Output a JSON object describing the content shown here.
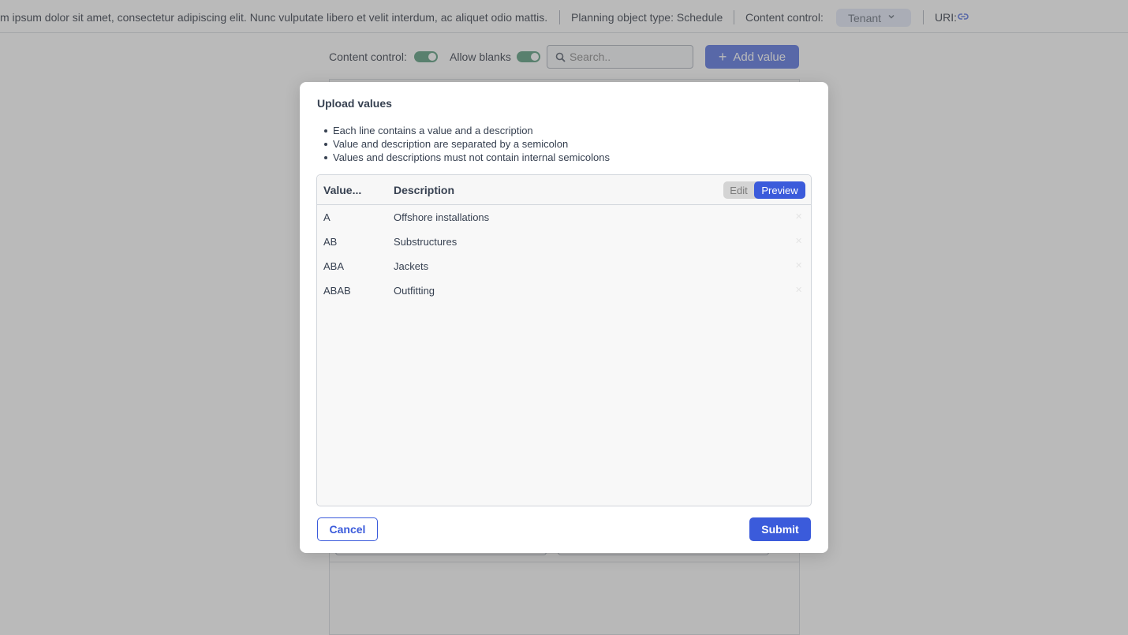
{
  "topbar": {
    "description": "m ipsum dolor sit amet, consectetur adipiscing elit. Nunc vulputate libero et velit interdum, ac aliquet odio mattis.",
    "planning_object_type": "Planning object type: Schedule",
    "content_control_label": "Content control:",
    "content_control_value": "Tenant",
    "uri_label": "URI:",
    "uri_icon": "link-icon"
  },
  "controls": {
    "content_control_label": "Content control:",
    "content_control_on": true,
    "allow_blanks_label": "Allow blanks",
    "allow_blanks_on": true,
    "search_placeholder": "Search..",
    "add_value_label": "Add value"
  },
  "modal": {
    "title": "Upload values",
    "instructions": [
      "Each line contains a value and a description",
      "Value and description are separated by a semicolon",
      "Values and descriptions must not contain internal semicolons"
    ],
    "table": {
      "col_value": "Value...",
      "col_description": "Description",
      "mode_edit": "Edit",
      "mode_preview": "Preview",
      "active_mode": "Preview",
      "rows": [
        {
          "value": "A",
          "description": "Offshore installations"
        },
        {
          "value": "AB",
          "description": "Substructures"
        },
        {
          "value": "ABA",
          "description": "Jackets"
        },
        {
          "value": "ABAB",
          "description": "Outfitting"
        }
      ]
    },
    "cancel_label": "Cancel",
    "submit_label": "Submit"
  },
  "colors": {
    "accent": "#3b5bdb",
    "toggle_on": "#3d8a66",
    "overlay": "rgba(118,118,118,0.5)"
  }
}
